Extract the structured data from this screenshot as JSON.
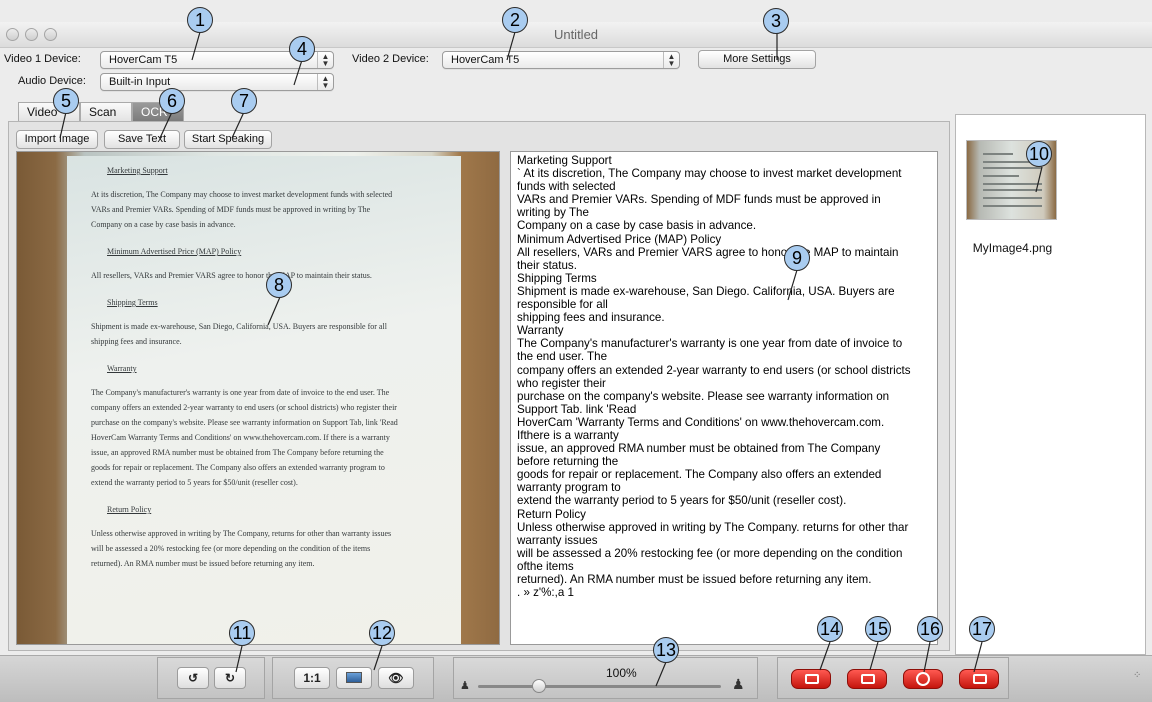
{
  "window": {
    "title": "Untitled"
  },
  "devices": {
    "video1_label": "Video 1 Device:",
    "video1_value": "HoverCam T5",
    "video2_label": "Video 2 Device:",
    "video2_value": "HoverCam T5",
    "audio_label": "Audio Device:",
    "audio_value": "Built-in Input",
    "more_settings": "More Settings"
  },
  "tabs": [
    {
      "label": "Video",
      "active": false
    },
    {
      "label": "Scan",
      "active": false
    },
    {
      "label": "OCR",
      "active": true
    }
  ],
  "ocr_toolbar": {
    "import_image": "Import Image",
    "save_text": "Save Text",
    "start_speaking": "Start Speaking"
  },
  "scan_lines": [
    {
      "text": "Marketing Support",
      "heading": true
    },
    {
      "text": "At its discretion, The Company may choose to invest market development funds with selected",
      "heading": false
    },
    {
      "text": "VARs and Premier VARs. Spending of MDF funds must be approved in writing by The",
      "heading": false
    },
    {
      "text": "Company on a case by case basis in advance.",
      "heading": false
    },
    {
      "text": "Minimum Advertised Price (MAP) Policy",
      "heading": true
    },
    {
      "text": "All resellers, VARs and Premier VARS agree to honor the MAP to maintain their status.",
      "heading": false
    },
    {
      "text": "Shipping Terms",
      "heading": true
    },
    {
      "text": "Shipment is made ex-warehouse, San Diego, California, USA. Buyers are responsible for all",
      "heading": false
    },
    {
      "text": "shipping fees and insurance.",
      "heading": false
    },
    {
      "text": "Warranty",
      "heading": true
    },
    {
      "text": "The Company's manufacturer's warranty is one year from date of invoice to the end user. The",
      "heading": false
    },
    {
      "text": "company offers an extended 2-year warranty to end users (or school districts) who register their",
      "heading": false
    },
    {
      "text": "purchase on the company's website. Please see warranty information on Support Tab, link 'Read",
      "heading": false
    },
    {
      "text": "HoverCam Warranty Terms and Conditions' on www.thehovercam.com. If there is a warranty",
      "heading": false
    },
    {
      "text": "issue, an approved RMA number must be obtained from The Company before returning the",
      "heading": false
    },
    {
      "text": "goods for repair or replacement. The Company also offers an extended warranty program to",
      "heading": false
    },
    {
      "text": "extend the warranty period to 5 years for $50/unit (reseller cost).",
      "heading": false
    },
    {
      "text": "Return Policy",
      "heading": true
    },
    {
      "text": "Unless otherwise approved in writing by The Company, returns for other than warranty issues",
      "heading": false
    },
    {
      "text": "will be assessed a 20% restocking fee (or more depending on the condition of the items",
      "heading": false
    },
    {
      "text": "returned). An RMA number must be issued before returning any item.",
      "heading": false
    }
  ],
  "ocr_text_lines": [
    "Marketing Support",
    "` At its discretion, The Company may choose to invest market development",
    "funds with selected",
    "VARs and Premier VARs. Spending of MDF funds must be approved in",
    "writing by The",
    "Company on a case by case basis in advance.",
    "Minimum Advertised Price (MAP) Policy",
    "All resellers, VARs and Premier VARS agree to honor the MAP to maintain",
    "their status.",
    "Shipping Terms",
    "Shipment is made ex-warehouse, San Diego. California, USA. Buyers are",
    "responsible for all",
    "shipping fees and insurance.",
    "Warranty",
    "The Company's manufacturer's warranty is one year from date of invoice to",
    "the end user. The",
    "company offers an extended 2-year warranty to end users (or school districts",
    "who register their",
    "purchase on the company's website. Please see warranty information on",
    "Support Tab. link 'Read",
    "HoverCam 'Warranty Terms and Conditions' on www.thehovercam.com.",
    "Ifthere is a warranty",
    "issue, an approved RMA number must be obtained from The Company",
    "before returning the",
    "goods for repair or replacement. The Company also offers an extended",
    "warranty program to",
    "extend the warranty period to 5 years for $50/unit (reseller cost).",
    "Return Policy",
    "Unless otherwise approved in writing by The Company. returns for other thar",
    "warranty issues",
    "will be assessed a 20% restocking fee (or more depending on the condition",
    "ofthe items",
    "returned). An RMA number must be issued before returning any item.",
    "   . » z'%:,a 1"
  ],
  "thumbnail": {
    "filename": "MyImage4.png"
  },
  "bottom": {
    "one_to_one": "1:1",
    "zoom_percent": "100%",
    "zoom_level_fraction": 0.25
  },
  "callouts": [
    "1",
    "2",
    "3",
    "4",
    "5",
    "6",
    "7",
    "8",
    "9",
    "10",
    "11",
    "12",
    "13",
    "14",
    "15",
    "16",
    "17"
  ]
}
